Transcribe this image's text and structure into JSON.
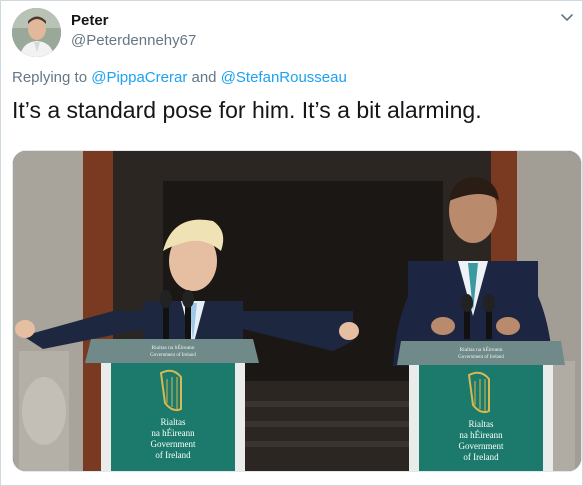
{
  "user": {
    "name": "Peter",
    "handle": "@Peterdennehy67"
  },
  "reply": {
    "prefix": "Replying to",
    "mention1": "@PippaCrerar",
    "conj": "and",
    "mention2": "@StefanRousseau"
  },
  "tweet": {
    "text": "It’s a standard pose for him. It’s a bit alarming."
  },
  "photo": {
    "podium_left": {
      "top_small": "Rialtas na hÉireann",
      "top_small2": "Government of Ireland",
      "line1": "Rialtas",
      "line2": "na hÉireann",
      "line3": "Government",
      "line4": "of Ireland"
    },
    "podium_right": {
      "top_small": "Rialtas na hÉireann",
      "top_small2": "Government of Ireland",
      "line1": "Rialtas",
      "line2": "na hÉireann",
      "line3": "Government",
      "line4": "of Ireland"
    }
  },
  "icons": {
    "menu": "chevron-down-icon"
  },
  "colors": {
    "link": "#1da1f2",
    "secondary": "#657786",
    "podium_green": "#1a7a6a"
  }
}
